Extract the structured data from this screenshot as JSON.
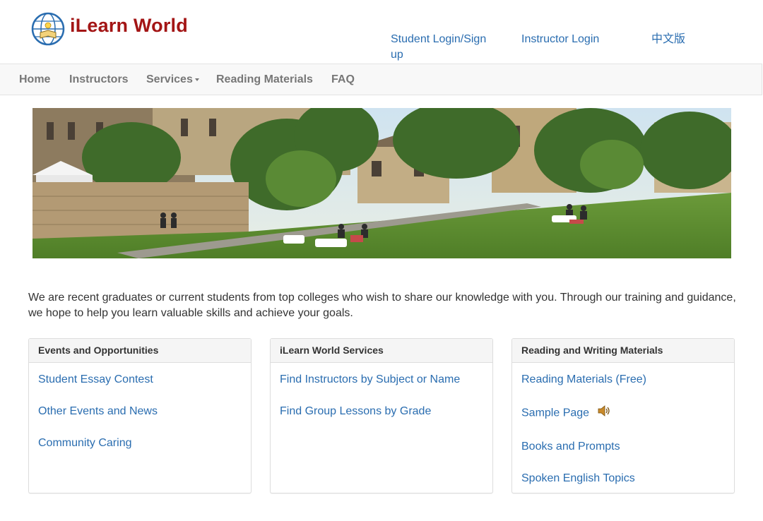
{
  "brand": {
    "name": "iLearn World"
  },
  "toplinks": {
    "student": "Student Login/Sign up",
    "instructor": "Instructor Login",
    "chinese": "中文版"
  },
  "nav": {
    "home": "Home",
    "instructors": "Instructors",
    "services": "Services",
    "reading": "Reading Materials",
    "faq": "FAQ"
  },
  "intro": "We are recent graduates or current students from top colleges who wish to share our knowledge with you. Through our training and guidance, we hope to help you learn valuable skills and achieve your goals.",
  "panels": [
    {
      "title": "Events and Opportunities",
      "links": [
        "Student Essay Contest",
        "Other Events and News",
        "Community Caring"
      ]
    },
    {
      "title": "iLearn World Services",
      "links": [
        "Find Instructors by Subject or Name",
        "Find Group Lessons by Grade"
      ]
    },
    {
      "title": "Reading and Writing Materials",
      "links": [
        "Reading Materials (Free)",
        "Sample Page",
        "Books and Prompts",
        "Spoken English Topics"
      ]
    }
  ],
  "colors": {
    "brand": "#a31515",
    "link": "#2a6db0",
    "nav_text": "#777777",
    "navbar_bg": "#f8f8f8",
    "panel_heading_bg": "#f5f5f5"
  }
}
